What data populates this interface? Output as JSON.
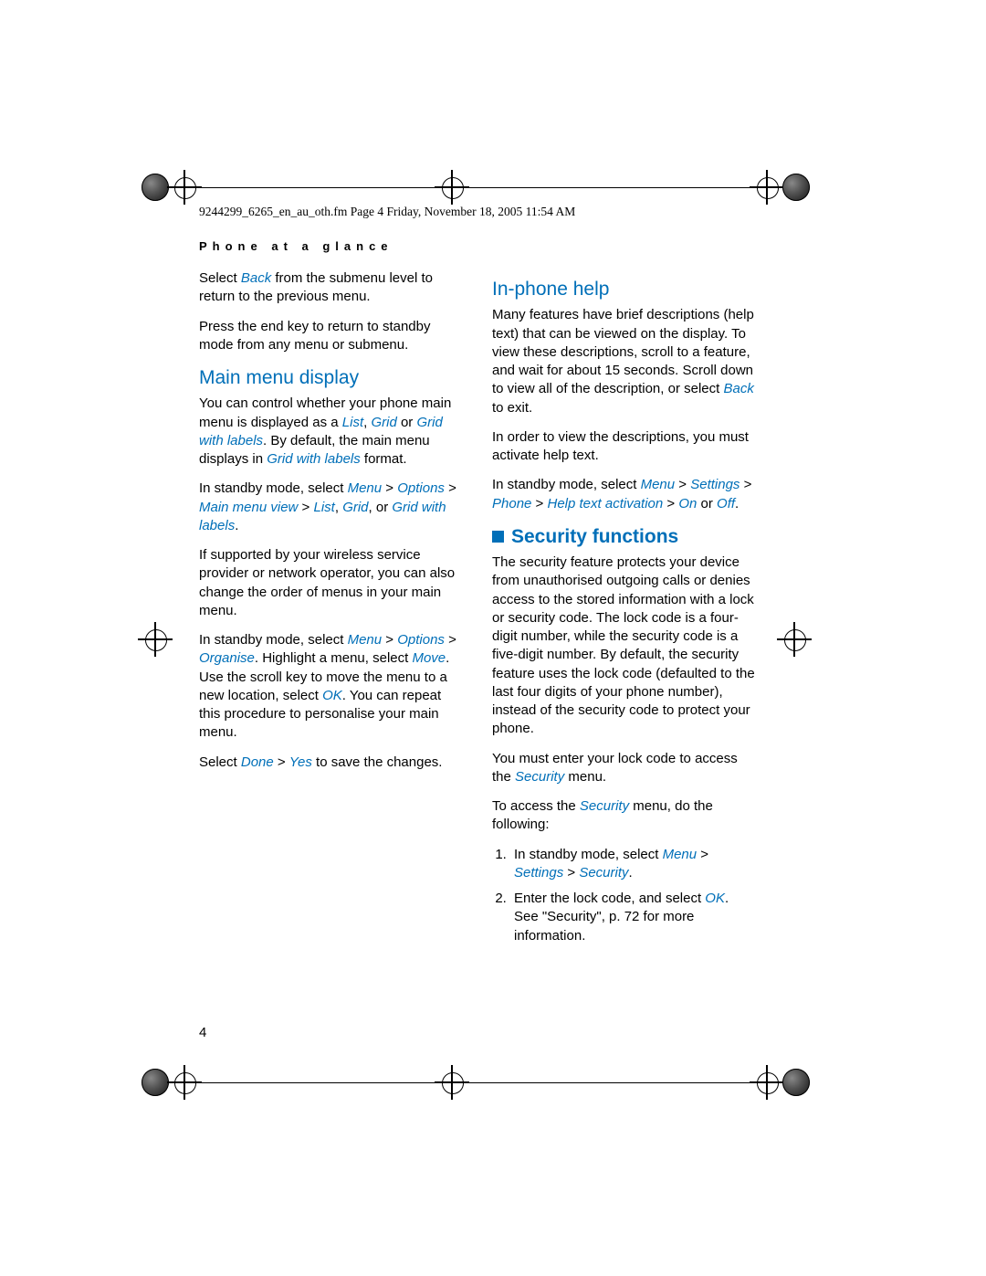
{
  "header_line": "9244299_6265_en_au_oth.fm  Page 4  Friday, November 18, 2005  11:54 AM",
  "section_title": "Phone at a glance",
  "page_number": "4",
  "col1": {
    "p1_a": "Select ",
    "p1_ui": "Back",
    "p1_b": " from the submenu level to return to the previous menu.",
    "p2": "Press the end key to return to standby mode from any menu or submenu.",
    "h_main": "Main menu display",
    "p3_a": "You can control whether your phone main menu is displayed as a ",
    "p3_ui1": "List",
    "p3_b": ", ",
    "p3_ui2": "Grid",
    "p3_c": " or ",
    "p3_ui3": "Grid with labels",
    "p3_d": ". By default, the  main menu displays in ",
    "p3_ui4": "Grid with labels",
    "p3_e": " format.",
    "p4_a": "In standby mode, select ",
    "p4_ui1": "Menu",
    "p4_b": " > ",
    "p4_ui2": "Options",
    "p4_c": " > ",
    "p4_ui3": "Main menu view",
    "p4_d": " > ",
    "p4_ui4": "List",
    "p4_e": ", ",
    "p4_ui5": "Grid",
    "p4_f": ", or ",
    "p4_ui6": "Grid with labels",
    "p4_g": ".",
    "p5": "If supported by your wireless service provider or network operator, you can also change the order of menus in your main menu.",
    "p6_a": "In standby mode, select ",
    "p6_ui1": "Menu",
    "p6_b": " > ",
    "p6_ui2": "Options",
    "p6_c": " > ",
    "p6_ui3": "Organise",
    "p6_d": ". Highlight a menu, select ",
    "p6_ui4": "Move",
    "p6_e": ". Use the scroll key to move the menu to a new location, select ",
    "p6_ui5": "OK",
    "p6_f": ". You can repeat this procedure to personalise your main menu.",
    "p7_a": "Select ",
    "p7_ui1": "Done",
    "p7_b": " > ",
    "p7_ui2": "Yes",
    "p7_c": " to save the changes."
  },
  "col2": {
    "h_help": "In-phone help",
    "p1_a": "Many features have brief descriptions (help text) that can be viewed on the display. To view these descriptions, scroll to a feature, and wait for about 15 seconds. Scroll down to view all of the description, or select ",
    "p1_ui": "Back",
    "p1_b": " to exit.",
    "p2": "In order to view the descriptions, you must activate help text.",
    "p3_a": "In standby mode, select ",
    "p3_ui1": "Menu",
    "p3_b": " > ",
    "p3_ui2": "Settings",
    "p3_c": " > ",
    "p3_ui3": "Phone",
    "p3_d": " > ",
    "p3_ui4": "Help text activation",
    "p3_e": " > ",
    "p3_ui5": "On",
    "p3_f": " or ",
    "p3_ui6": "Off",
    "p3_g": ".",
    "h_sec": "Security functions",
    "ps1": "The security feature protects your device from unauthorised outgoing calls or denies access to the stored information with a lock or security code. The lock code is a four-digit number, while the security code is a five-digit number. By default, the security feature uses the lock code (defaulted to the last four digits of your phone number), instead of the security code to protect your phone.",
    "ps2_a": "You must enter your lock code to access the ",
    "ps2_ui": "Security",
    "ps2_b": " menu.",
    "ps3_a": "To access the ",
    "ps3_ui": "Security",
    "ps3_b": " menu, do the following:",
    "li1_a": "In standby mode, select ",
    "li1_ui1": "Menu",
    "li1_b": " > ",
    "li1_ui2": "Settings",
    "li1_c": " > ",
    "li1_ui3": "Security",
    "li1_d": ".",
    "li2_a": "Enter the lock code, and select ",
    "li2_ui": "OK",
    "li2_b": ". See \"Security\", p. 72 for more information."
  }
}
